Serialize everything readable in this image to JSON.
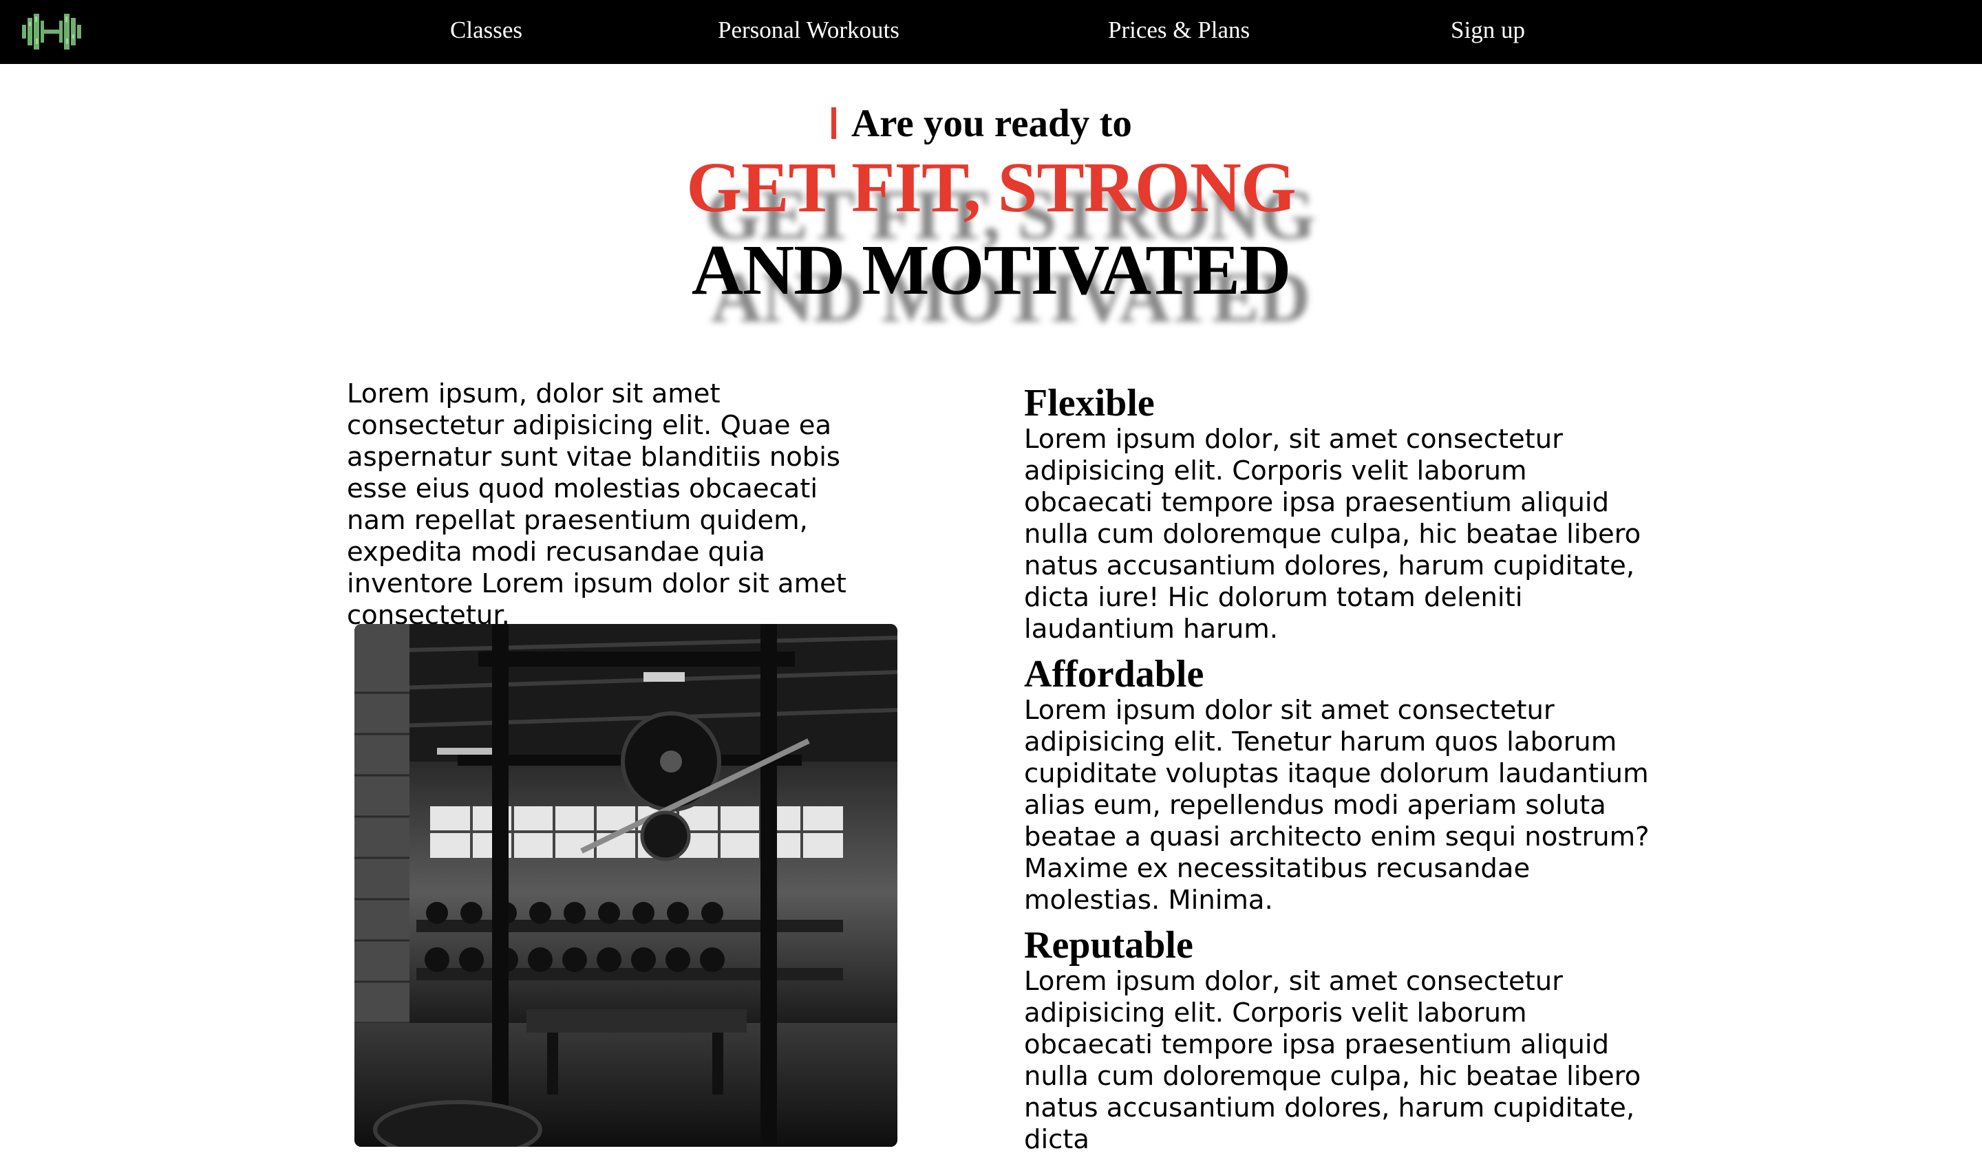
{
  "nav": {
    "logo_icon": "dumbbell-logo-icon",
    "links": [
      {
        "label": "Classes"
      },
      {
        "label": "Personal Workouts"
      },
      {
        "label": "Prices & Plans"
      },
      {
        "label": "Sign up"
      }
    ]
  },
  "hero": {
    "intro": "Are you ready to",
    "line1": "GET FIT, STRONG",
    "line2": "AND MOTIVATED"
  },
  "intro": {
    "text": "Lorem ipsum, dolor sit amet consectetur adipisicing elit. Quae ea aspernatur sunt vitae blanditiis nobis esse eius quod molestias obcaecati nam repellat praesentium quidem, expedita modi recusandae quia inventore Lorem ipsum dolor sit amet consectetur."
  },
  "features": [
    {
      "title": "Flexible",
      "text": "Lorem ipsum dolor, sit amet consectetur adipisicing elit. Corporis velit laborum obcaecati tempore ipsa praesentium aliquid nulla cum doloremque culpa, hic beatae libero natus accusantium dolores, harum cupiditate, dicta iure! Hic dolorum totam deleniti laudantium harum."
    },
    {
      "title": "Affordable",
      "text": "Lorem ipsum dolor sit amet consectetur adipisicing elit. Tenetur harum quos laborum cupiditate voluptas itaque dolorum laudantium alias eum, repellendus modi aperiam soluta beatae a quasi architecto enim sequi nostrum? Maxime ex necessitatibus recusandae molestias. Minima."
    },
    {
      "title": "Reputable",
      "text": "Lorem ipsum dolor, sit amet consectetur adipisicing elit. Corporis velit laborum obcaecati tempore ipsa praesentium aliquid nulla cum doloremque culpa, hic beatae libero natus accusantium dolores, harum cupiditate, dicta"
    }
  ],
  "colors": {
    "accent": "#e53a2d",
    "nav_bg": "#000000",
    "logo_green": "#7bc47a"
  }
}
